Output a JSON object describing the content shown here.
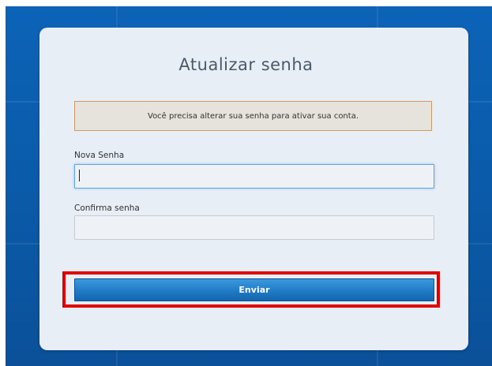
{
  "page": {
    "title": "Atualizar senha",
    "alert_message": "Você precisa alterar sua senha para ativar sua conta."
  },
  "form": {
    "new_password_label": "Nova Senha",
    "new_password_value": "",
    "confirm_password_label": "Confirma senha",
    "confirm_password_value": "",
    "submit_label": "Enviar"
  },
  "colors": {
    "background": "#0b5aa8",
    "card": "#e8eef6",
    "alert_border": "#cf9a66",
    "button": "#1f7bc5",
    "highlight": "#e00000"
  }
}
